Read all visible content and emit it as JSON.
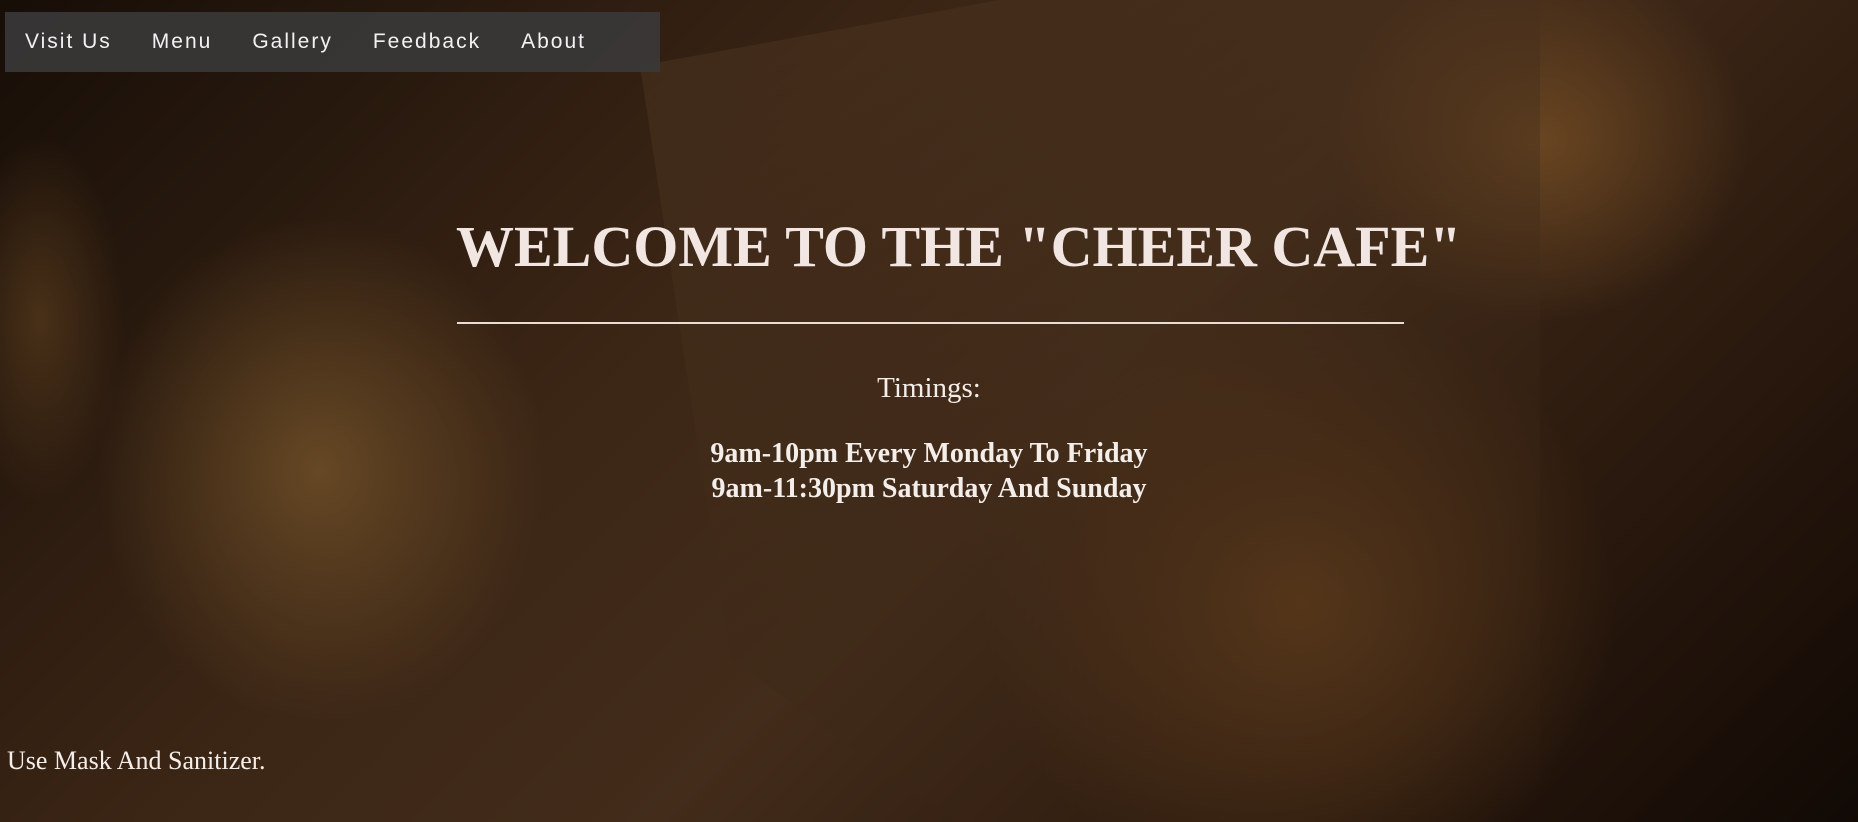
{
  "nav": {
    "items": [
      {
        "label": "Visit Us"
      },
      {
        "label": "Menu"
      },
      {
        "label": "Gallery"
      },
      {
        "label": "Feedback"
      },
      {
        "label": "About"
      }
    ]
  },
  "hero": {
    "title": "WELCOME TO THE \"CHEER CAFE\"",
    "timings_label": "Timings:",
    "timings": [
      "9am-10pm Every Monday To Friday",
      "9am-11:30pm Saturday And Sunday"
    ]
  },
  "footer": {
    "note": "Use Mask And Sanitizer."
  }
}
